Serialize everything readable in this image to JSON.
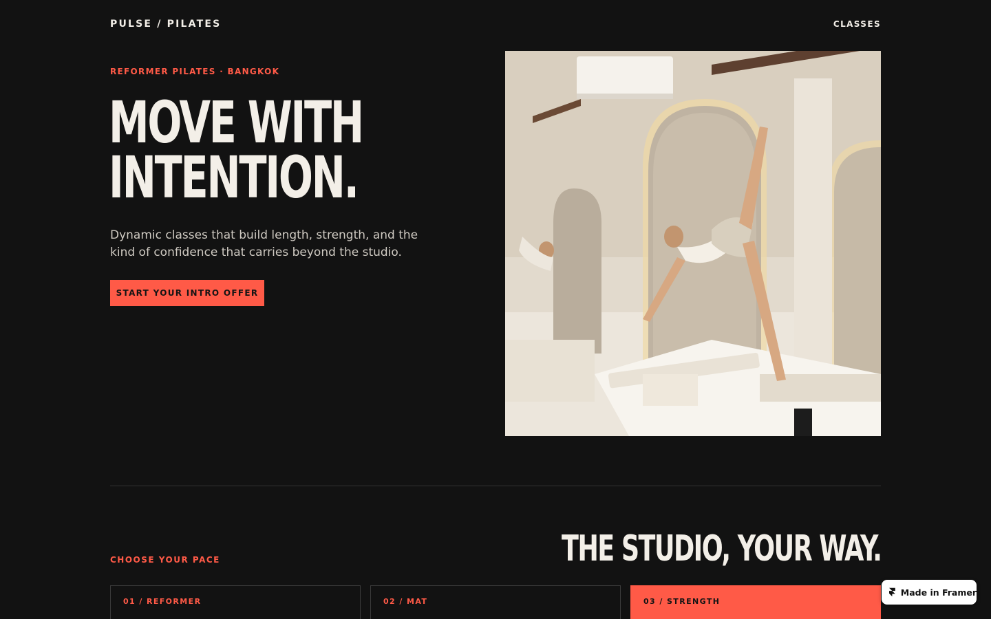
{
  "nav": {
    "logo": "PULSE / PILATES",
    "link": "CLASSES"
  },
  "hero": {
    "eyebrow": "REFORMER PILATES · BANGKOK",
    "headline_line1": "MOVE WITH",
    "headline_line2": "INTENTION.",
    "subtext": "Dynamic classes that build length, strength, and the kind of confidence that carries beyond the studio.",
    "cta_label": "START YOUR INTRO OFFER",
    "photo_icon": "photo-of-reformer-pilates-studio"
  },
  "studio": {
    "title": "THE STUDIO, YOUR WAY.",
    "pace_label": "CHOOSE YOUR PACE",
    "cards": [
      {
        "label": "01 / REFORMER"
      },
      {
        "label": "02 / MAT"
      },
      {
        "label": "03 / STRENGTH"
      }
    ]
  },
  "badge": {
    "label": "Made in Framer",
    "icon": "framer-logo-icon"
  },
  "colors": {
    "background": "#121212",
    "accent": "#ff5a47",
    "text": "#f3efe8"
  }
}
